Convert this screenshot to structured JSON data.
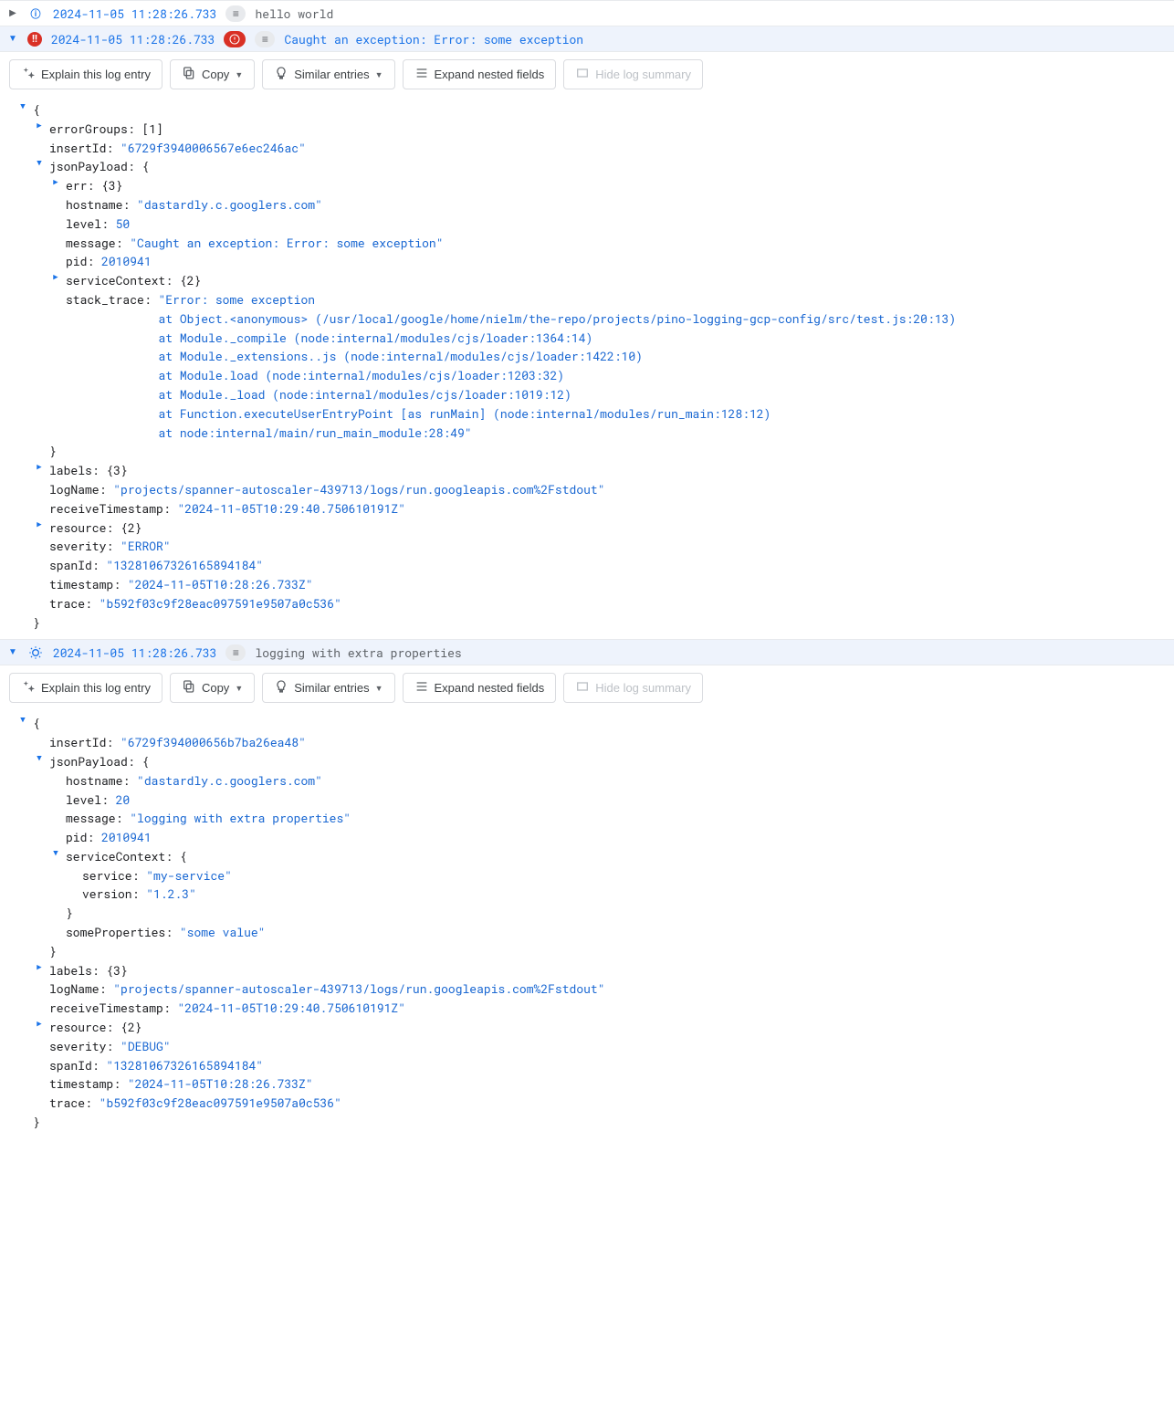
{
  "buttons": {
    "explain": "Explain this log entry",
    "copy": "Copy",
    "similar": "Similar entries",
    "expand": "Expand nested fields",
    "hide": "Hide log summary"
  },
  "entries": [
    {
      "expanded": false,
      "severity": "info",
      "timestamp": "2024-11-05 11:28:26.733",
      "message": "hello world"
    },
    {
      "expanded": true,
      "severity": "error",
      "timestamp": "2024-11-05 11:28:26.733",
      "message": "Caught an exception: Error: some exception",
      "json": {
        "errorGroups_summary": "[1]",
        "insertId": "6729f3940006567e6ec246ac",
        "jsonPayload": {
          "err_summary": "{3}",
          "hostname": "dastardly.c.googlers.com",
          "level": 50,
          "message": "Caught an exception: Error: some exception",
          "pid": 2010941,
          "serviceContext_summary": "{2}",
          "stack_trace": [
            "Error: some exception",
            "    at Object.<anonymous> (/usr/local/google/home/nielm/the-repo/projects/pino-logging-gcp-config/src/test.js:20:13)",
            "    at Module._compile (node:internal/modules/cjs/loader:1364:14)",
            "    at Module._extensions..js (node:internal/modules/cjs/loader:1422:10)",
            "    at Module.load (node:internal/modules/cjs/loader:1203:32)",
            "    at Module._load (node:internal/modules/cjs/loader:1019:12)",
            "    at Function.executeUserEntryPoint [as runMain] (node:internal/modules/run_main:128:12)",
            "    at node:internal/main/run_main_module:28:49"
          ]
        },
        "labels_summary": "{3}",
        "logName": "projects/spanner-autoscaler-439713/logs/run.googleapis.com%2Fstdout",
        "receiveTimestamp": "2024-11-05T10:29:40.750610191Z",
        "resource_summary": "{2}",
        "severity": "ERROR",
        "spanId": "13281067326165894184",
        "timestamp": "2024-11-05T10:28:26.733Z",
        "trace": "b592f03c9f28eac097591e9507a0c536"
      }
    },
    {
      "expanded": true,
      "severity": "debug",
      "timestamp": "2024-11-05 11:28:26.733",
      "message": "logging with extra properties",
      "json": {
        "insertId": "6729f394000656b7ba26ea48",
        "jsonPayload": {
          "hostname": "dastardly.c.googlers.com",
          "level": 20,
          "message": "logging with extra properties",
          "pid": 2010941,
          "serviceContext": {
            "service": "my-service",
            "version": "1.2.3"
          },
          "someProperties": "some value"
        },
        "labels_summary": "{3}",
        "logName": "projects/spanner-autoscaler-439713/logs/run.googleapis.com%2Fstdout",
        "receiveTimestamp": "2024-11-05T10:29:40.750610191Z",
        "resource_summary": "{2}",
        "severity": "DEBUG",
        "spanId": "13281067326165894184",
        "timestamp": "2024-11-05T10:28:26.733Z",
        "trace": "b592f03c9f28eac097591e9507a0c536"
      }
    }
  ]
}
